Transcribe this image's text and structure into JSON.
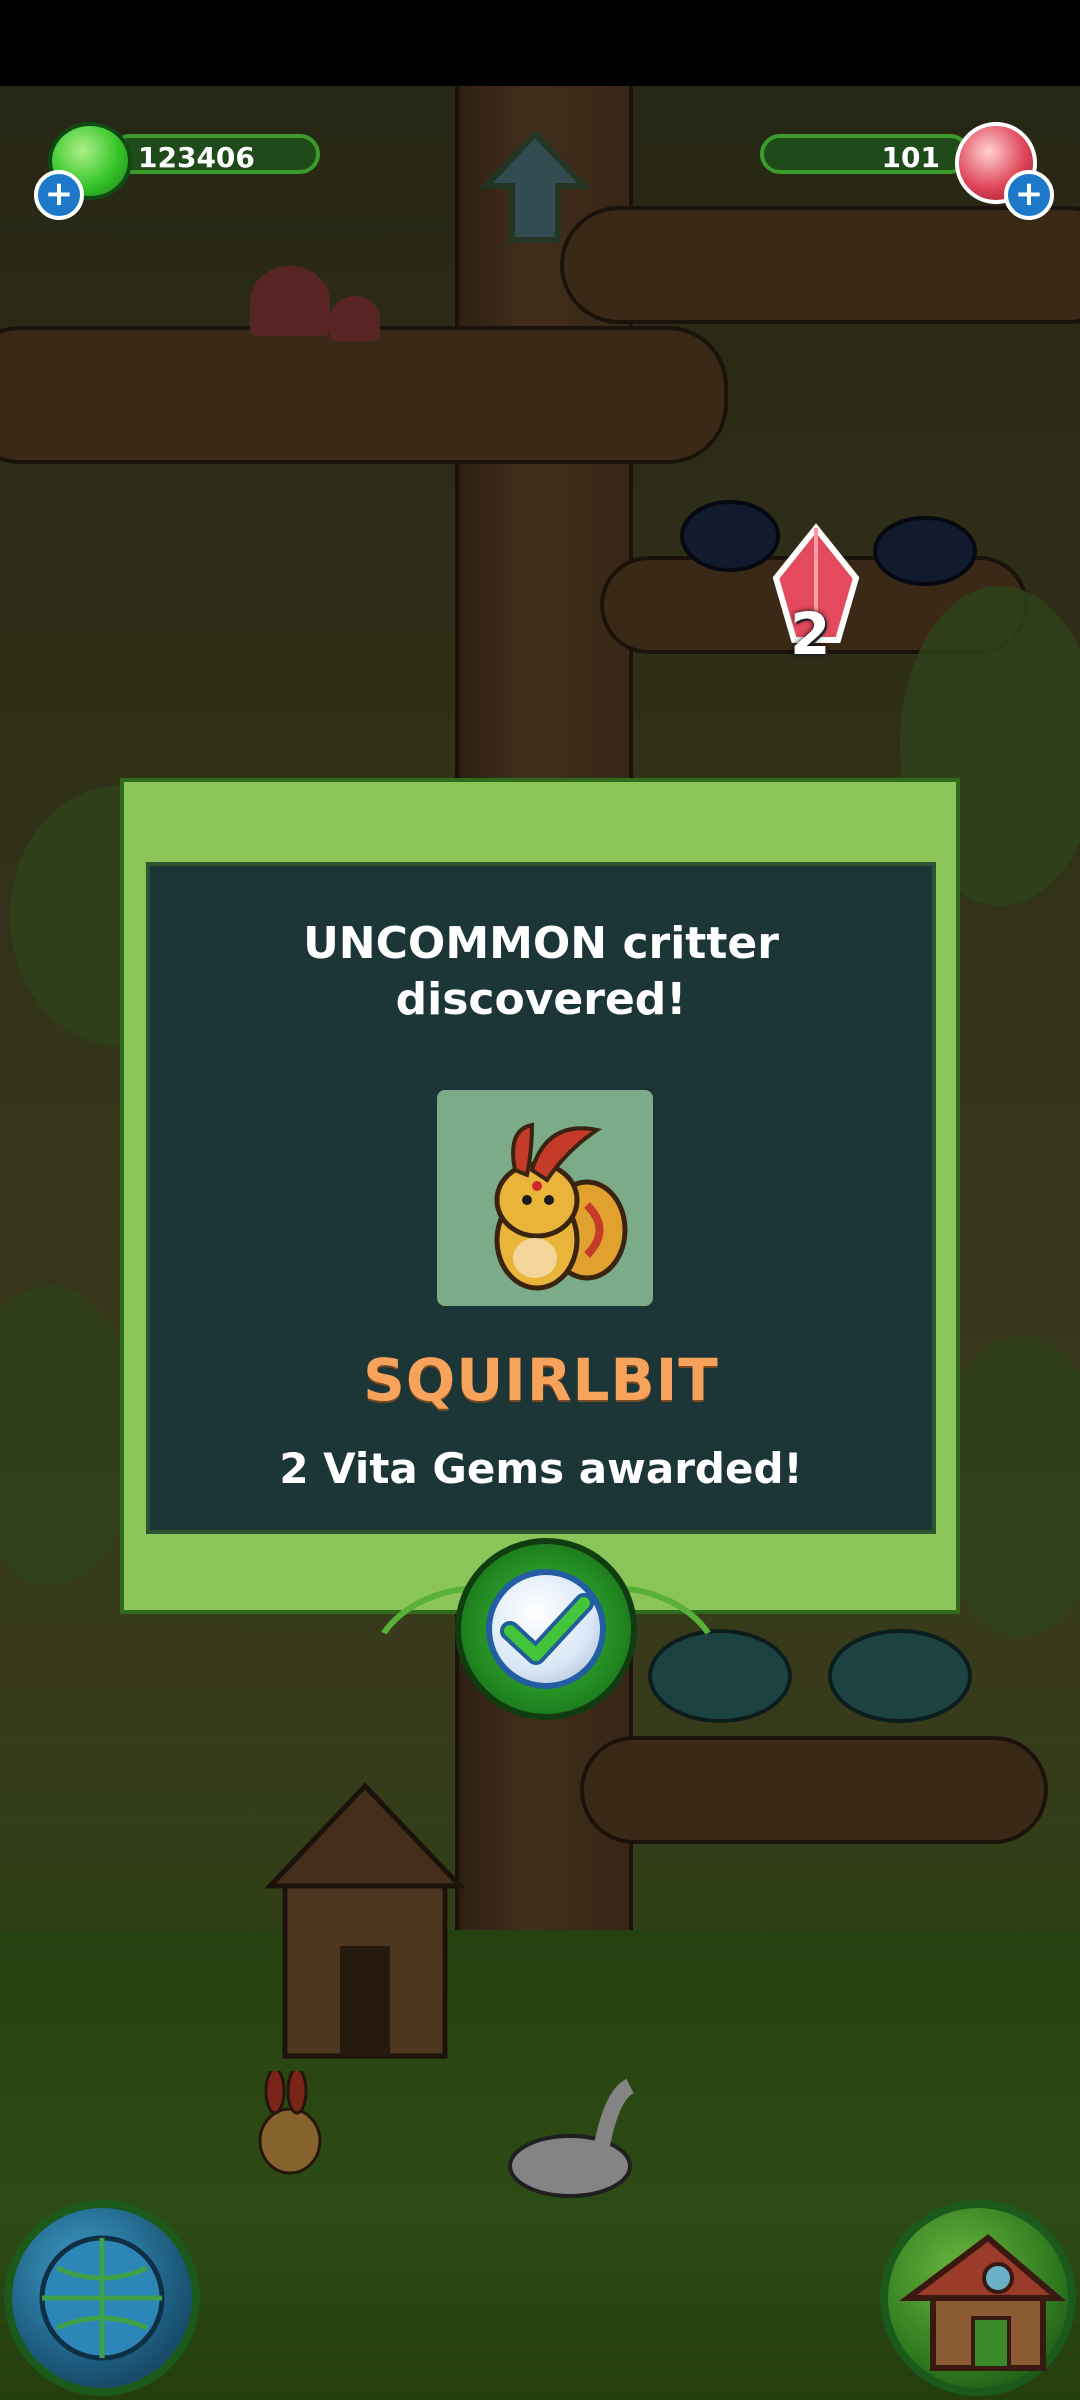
{
  "hud": {
    "green_gem_count": "123406",
    "vita_gem_count": "101",
    "floating_gem_reward": "2"
  },
  "dialog": {
    "title_line1": "UNCOMMON critter",
    "title_line2": "discovered!",
    "critter_name": "SQUIRLBIT",
    "award_text": "2 Vita Gems awarded!"
  },
  "colors": {
    "dialog_frame": "#8bc55a",
    "dialog_panel": "#1c3537",
    "critter_name": "#f7a35c"
  },
  "icons": {
    "confirm": "checkmark-icon",
    "world": "globe-icon",
    "home": "house-icon"
  }
}
